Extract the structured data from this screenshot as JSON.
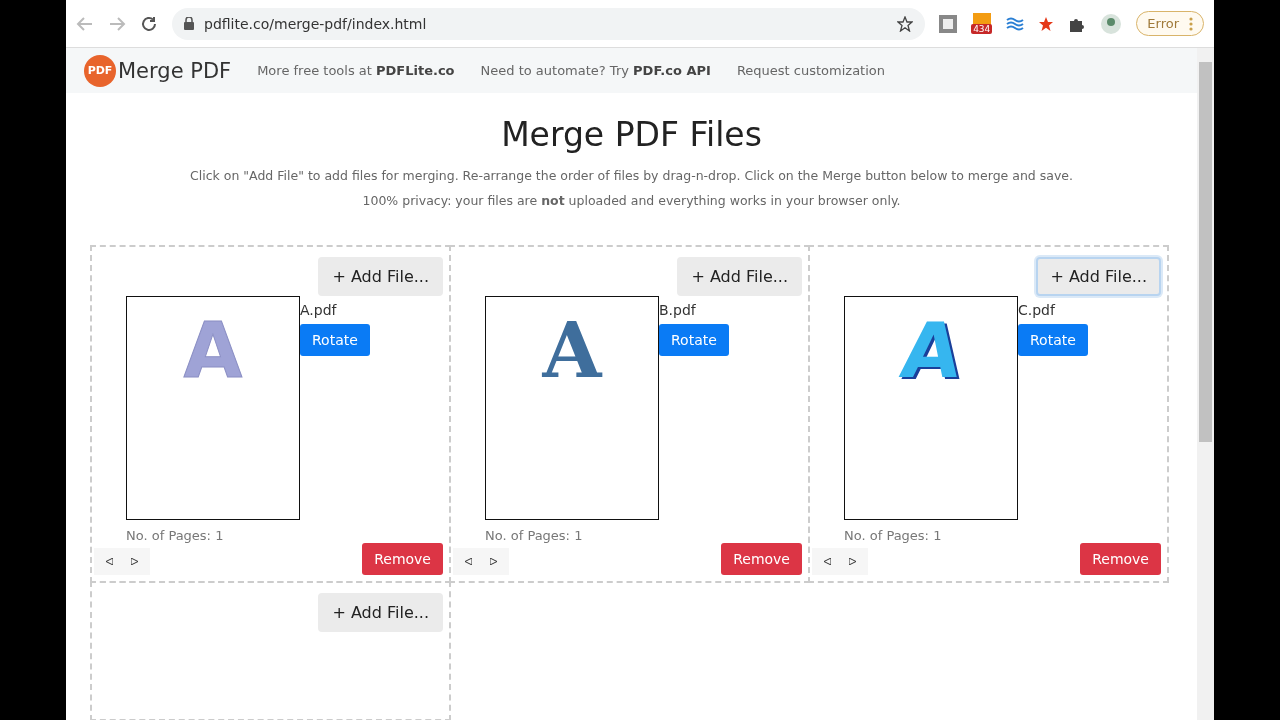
{
  "browser": {
    "url": "pdflite.co/merge-pdf/index.html",
    "extension_badge": "434",
    "profile_button": "Error"
  },
  "header": {
    "logo_text": "PDF",
    "brand": "Merge PDF",
    "links": [
      "More free tools at **PDFLite.co**",
      "Need to automate? Try **PDF.co API**",
      "Request customization"
    ]
  },
  "title": "Merge PDF Files",
  "intro": [
    "Click on \"Add File\" to add files for merging. Re-arrange the order of files by drag-n-drop. Click on the Merge button below to merge and save.",
    "100% privacy: your files are **not** uploaded and everything works in your browser only."
  ],
  "files": [
    {
      "add_button": "+ Add File...",
      "focused": false,
      "name": "A.pdf",
      "preview_letter": "A",
      "kind": "sans",
      "color": "#9fa3d6",
      "rotate_button": "Rotate",
      "pages": "No. of Pages: 1",
      "remove_button": "Remove"
    },
    {
      "add_button": "+ Add File...",
      "focused": false,
      "name": "B.pdf",
      "preview_letter": "A",
      "kind": "serif",
      "color": "#3f6e9c",
      "rotate_button": "Rotate",
      "pages": "No. of Pages: 1",
      "remove_button": "Remove"
    },
    {
      "add_button": "+ Add File...",
      "focused": true,
      "name": "C.pdf",
      "preview_letter": "A",
      "kind": "bubble",
      "color": "#36b6ef",
      "rotate_button": "Rotate",
      "pages": "No. of Pages: 1",
      "remove_button": "Remove"
    }
  ],
  "empty_slot": {
    "add_button": "+ Add File..."
  }
}
